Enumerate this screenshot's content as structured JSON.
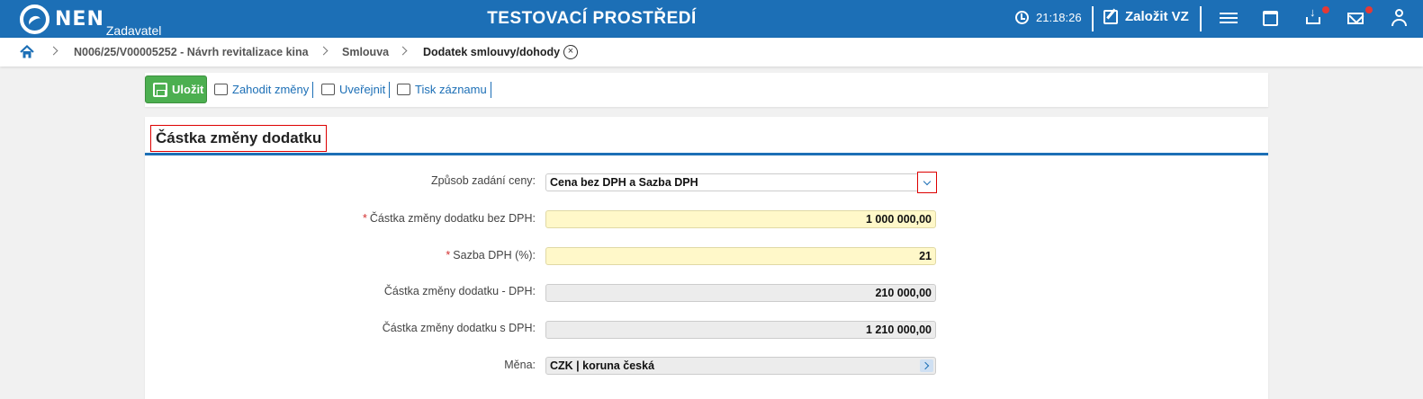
{
  "header": {
    "logo_text": "NEN",
    "logo_sub": "Zadavatel",
    "env_title": "TESTOVACÍ PROSTŘEDÍ",
    "clock": "21:18:26",
    "new_vz_label": "Založit VZ",
    "icons": [
      "clock-icon",
      "edit-icon",
      "menu-icon",
      "calendar-icon",
      "download-icon",
      "mail-icon",
      "user-icon"
    ],
    "accent_color": "#1c6fb6",
    "notification_color": "#e53935"
  },
  "breadcrumb": {
    "items": [
      "N006/25/V00005252 - Návrh revitalizace kina",
      "Smlouva",
      "Dodatek smlouvy/dohody"
    ]
  },
  "toolbar": {
    "save_label": "Uložit",
    "discard_label": "Zahodit změny",
    "publish_label": "Uveřejnit",
    "print_label": "Tisk záznamu",
    "save_color": "#4caf50"
  },
  "form": {
    "title": "Částka změny dodatku",
    "fields": [
      {
        "label": "Způsob zadání ceny:",
        "value": "Cena bez DPH a Sazba DPH",
        "required": false
      },
      {
        "label": "Částka změny dodatku bez DPH:",
        "value": "1 000 000,00",
        "required": true
      },
      {
        "label": "Sazba DPH (%):",
        "value": "21",
        "required": true
      },
      {
        "label": "Částka změny dodatku - DPH:",
        "value": "210 000,00",
        "required": false
      },
      {
        "label": "Částka změny dodatku s DPH:",
        "value": "1 210 000,00",
        "required": false
      },
      {
        "label": "Měna:",
        "value": "CZK | koruna česká",
        "required": false
      }
    ],
    "required_mark": "*"
  }
}
